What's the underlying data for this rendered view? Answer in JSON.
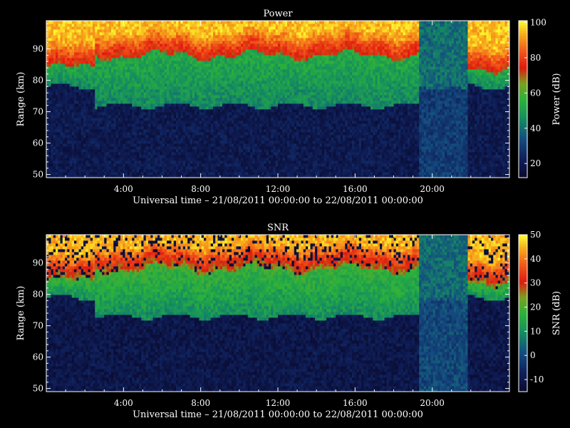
{
  "figure": {
    "background": "#000000",
    "foreground": "#ffffff"
  },
  "colormap": {
    "name": "blue-green-red-yellow",
    "stops": [
      {
        "pos": 0.0,
        "color": "#0a0a2e"
      },
      {
        "pos": 0.12,
        "color": "#0f1f5a"
      },
      {
        "pos": 0.25,
        "color": "#144d80"
      },
      {
        "pos": 0.38,
        "color": "#158f5f"
      },
      {
        "pos": 0.5,
        "color": "#2db23a"
      },
      {
        "pos": 0.6,
        "color": "#7aa11e"
      },
      {
        "pos": 0.7,
        "color": "#e01a10"
      },
      {
        "pos": 0.82,
        "color": "#f2611a"
      },
      {
        "pos": 0.92,
        "color": "#f7b21c"
      },
      {
        "pos": 1.0,
        "color": "#ffff30"
      }
    ]
  },
  "chart_data": [
    {
      "type": "heatmap",
      "title": "Power",
      "xlabel": "Universal time – 21/08/2011 00:00:00 to 22/08/2011 00:00:00",
      "ylabel": "Range (km)",
      "xlim_hours": [
        0,
        24
      ],
      "ylim_km": [
        49,
        99
      ],
      "x_tick_labels": [
        {
          "hour": 4,
          "label": "4:00"
        },
        {
          "hour": 8,
          "label": "8:00"
        },
        {
          "hour": 12,
          "label": "12:00"
        },
        {
          "hour": 16,
          "label": "16:00"
        },
        {
          "hour": 20,
          "label": "20:00"
        }
      ],
      "y_ticks": [
        50,
        60,
        70,
        80,
        90
      ],
      "y_tick_labels": [
        "50",
        "60",
        "70",
        "80",
        "90"
      ],
      "colorbar": {
        "label": "Power (dB)",
        "range": [
          12,
          101
        ],
        "ticks": [
          20,
          40,
          60,
          80,
          100
        ],
        "tick_labels": [
          "20",
          "40",
          "60",
          "80",
          "100"
        ]
      },
      "value_profile": {
        "low_value": 20,
        "mid_value": 45,
        "high_value": 72,
        "peak_value": 95,
        "low_layer_top_km": 72,
        "mid_layer_top_km_night": 84,
        "mid_layer_top_km_day": 88
      }
    },
    {
      "type": "heatmap",
      "title": "SNR",
      "xlabel": "Universal time – 21/08/2011 00:00:00 to 22/08/2011 00:00:00",
      "ylabel": "Range (km)",
      "xlim_hours": [
        0,
        24
      ],
      "ylim_km": [
        49,
        99
      ],
      "x_tick_labels": [
        {
          "hour": 4,
          "label": "4:00"
        },
        {
          "hour": 8,
          "label": "8:00"
        },
        {
          "hour": 12,
          "label": "12:00"
        },
        {
          "hour": 16,
          "label": "16:00"
        },
        {
          "hour": 20,
          "label": "20:00"
        }
      ],
      "y_ticks": [
        50,
        60,
        70,
        80,
        90
      ],
      "y_tick_labels": [
        "50",
        "60",
        "70",
        "80",
        "90"
      ],
      "colorbar": {
        "label": "SNR (dB)",
        "range": [
          -15,
          50
        ],
        "ticks": [
          -10,
          0,
          10,
          20,
          30,
          40,
          50
        ],
        "tick_labels": [
          "-10",
          "0",
          "10",
          "20",
          "30",
          "40",
          "50"
        ]
      },
      "value_profile": {
        "low_value": -10,
        "mid_value": 10,
        "high_value": 25,
        "peak_value": 45,
        "low_layer_top_km": 73,
        "mid_layer_top_km_night": 84,
        "mid_layer_top_km_day": 88
      }
    }
  ]
}
